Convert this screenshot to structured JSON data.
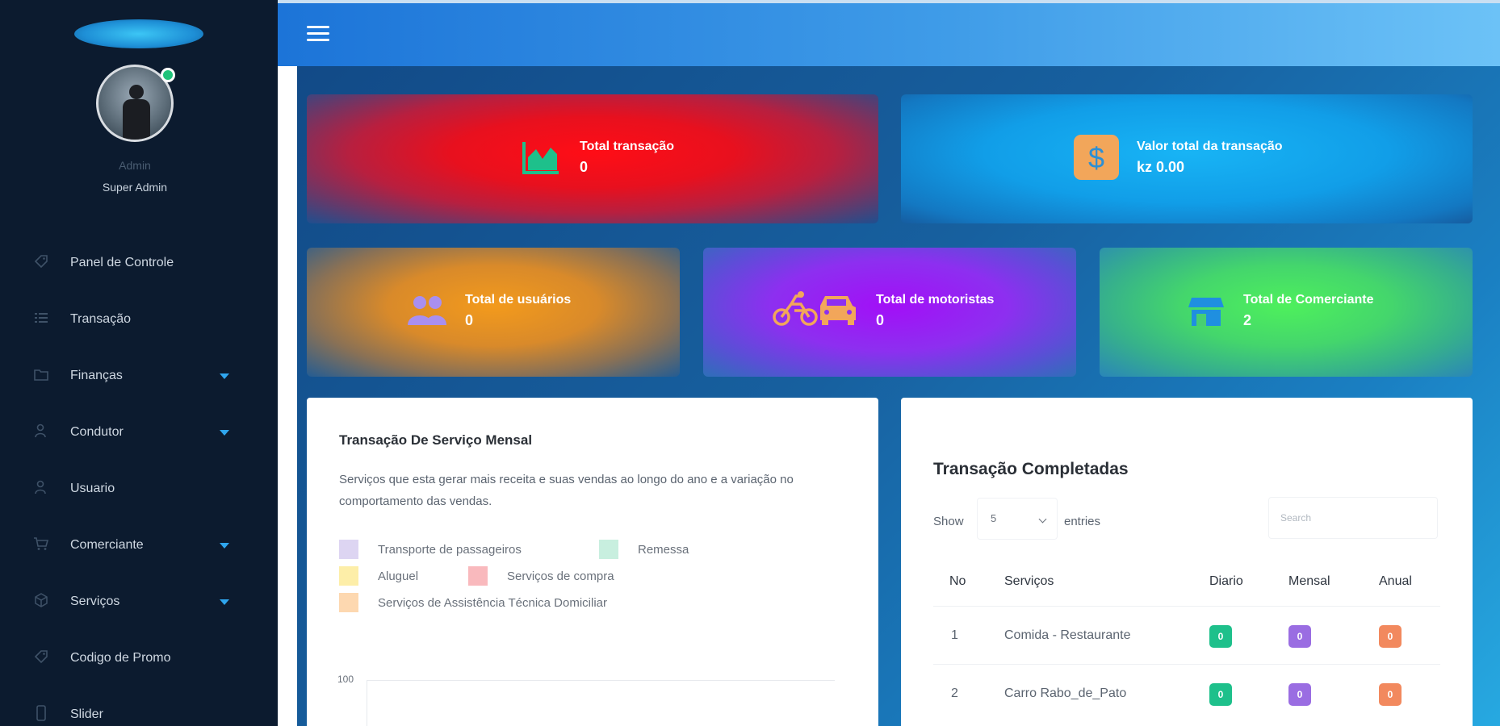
{
  "profile": {
    "name": "Admin",
    "role": "Super Admin",
    "status_color": "#20c37a"
  },
  "sidebar": {
    "items": [
      {
        "label": "Panel de Controle",
        "icon": "tag-icon",
        "has_submenu": false
      },
      {
        "label": "Transação",
        "icon": "list-icon",
        "has_submenu": false
      },
      {
        "label": "Finanças",
        "icon": "folder-icon",
        "has_submenu": true
      },
      {
        "label": "Condutor",
        "icon": "user-lock-icon",
        "has_submenu": true
      },
      {
        "label": "Usuario",
        "icon": "user-lock-icon",
        "has_submenu": false
      },
      {
        "label": "Comerciante",
        "icon": "cart-icon",
        "has_submenu": true
      },
      {
        "label": "Serviços",
        "icon": "cube-icon",
        "has_submenu": true
      },
      {
        "label": "Codigo de Promo",
        "icon": "tag-icon",
        "has_submenu": false
      },
      {
        "label": "Slider",
        "icon": "phone-icon",
        "has_submenu": false
      }
    ]
  },
  "stats": {
    "total_transacao": {
      "title": "Total transação",
      "value": "0",
      "icon": "line-chart-icon"
    },
    "valor_total": {
      "title": "Valor total da transação",
      "value": "kz 0.00",
      "icon": "dollar-icon"
    },
    "total_usuarios": {
      "title": "Total de usuários",
      "value": "0",
      "icon": "users-icon"
    },
    "total_motoristas": {
      "title": "Total de motoristas",
      "value": "0",
      "icon": "motorcycle-car-icon"
    },
    "total_comerciante": {
      "title": "Total de Comerciante",
      "value": "2",
      "icon": "store-icon"
    }
  },
  "chart": {
    "title": "Transação De Serviço Mensal",
    "description": "Serviços que esta gerar mais receita e suas vendas ao longo do ano e a variação no comportamento das vendas.",
    "legend": [
      {
        "label": "Transporte de passageiros",
        "color": "#ddd5f2"
      },
      {
        "label": "Remessa",
        "color": "#c8efdf"
      },
      {
        "label": "Aluguel",
        "color": "#fdeea8"
      },
      {
        "label": "Serviços de compra",
        "color": "#f9b9bd"
      },
      {
        "label": "Serviços de Assistência Técnica Domiciliar",
        "color": "#fdd8b0"
      }
    ],
    "y_max_label": "100"
  },
  "table": {
    "title": "Transação Completadas",
    "show_label": "Show",
    "entries_value": "5",
    "entries_label": "entries",
    "search_placeholder": "Search",
    "headers": [
      "No",
      "Serviços",
      "Diario",
      "Mensal",
      "Anual"
    ],
    "rows": [
      {
        "no": "1",
        "servico": "Comida - Restaurante",
        "diario": "0",
        "mensal": "0",
        "anual": "0"
      },
      {
        "no": "2",
        "servico": "Carro Rabo_de_Pato",
        "diario": "0",
        "mensal": "0",
        "anual": "0"
      }
    ]
  }
}
